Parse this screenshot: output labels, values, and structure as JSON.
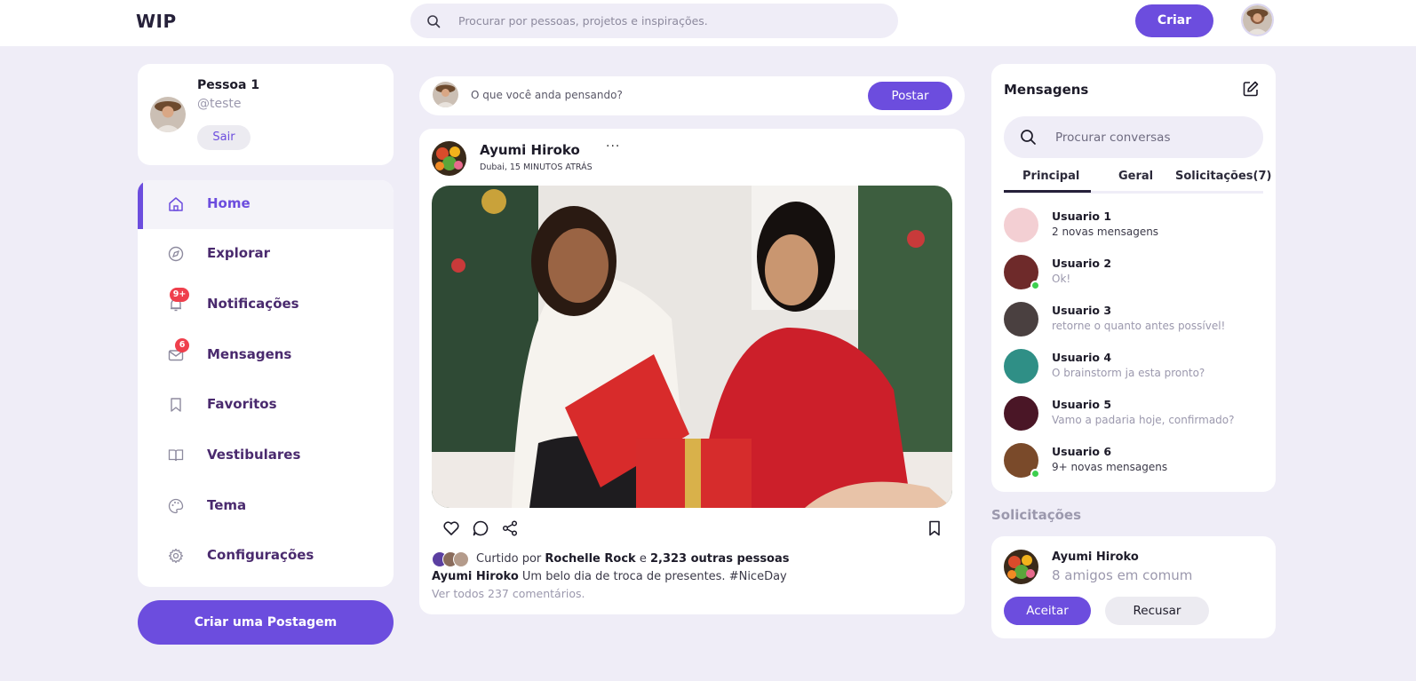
{
  "app": {
    "logo": "WIP"
  },
  "header": {
    "search_placeholder": "Procurar por pessoas, projetos e inspirações.",
    "create_label": "Criar"
  },
  "profile": {
    "name": "Pessoa 1",
    "handle": "@teste",
    "logout_label": "Sair"
  },
  "sidebar": {
    "items": [
      {
        "label": "Home",
        "icon": "home-icon",
        "active": true
      },
      {
        "label": "Explorar",
        "icon": "compass-icon"
      },
      {
        "label": "Notificações",
        "icon": "bell-icon",
        "badge": "9+"
      },
      {
        "label": "Mensagens",
        "icon": "mail-icon",
        "badge": "6"
      },
      {
        "label": "Favoritos",
        "icon": "bookmark-icon"
      },
      {
        "label": "Vestibulares",
        "icon": "book-icon"
      },
      {
        "label": "Tema",
        "icon": "palette-icon"
      },
      {
        "label": "Configurações",
        "icon": "gear-icon"
      }
    ],
    "create_post_label": "Criar uma Postagem"
  },
  "composer": {
    "placeholder": "O que você anda pensando?",
    "post_label": "Postar"
  },
  "post": {
    "author": "Ayumi Hiroko",
    "meta": "Dubai, 15 MINUTOS ATRÁS",
    "menu": "···",
    "likes_prefix": "Curtido por",
    "liked_by": "Rochelle Rock",
    "likes_joiner": "e",
    "likes_others": "2,323 outras pessoas",
    "caption_author": "Ayumi Hiroko",
    "caption_text": "Um belo dia de troca de presentes. #NiceDay",
    "comments_label": "Ver todos 237 comentários."
  },
  "messages": {
    "title": "Mensagens",
    "search_placeholder": "Procurar conversas",
    "tabs": [
      "Principal",
      "Geral",
      "Solicitações(7)"
    ],
    "conversations": [
      {
        "name": "Usuario 1",
        "message": "2 novas mensagens",
        "unread": true,
        "online": false
      },
      {
        "name": "Usuario 2",
        "message": "Ok!",
        "unread": false,
        "online": true
      },
      {
        "name": "Usuario 3",
        "message": "retorne o quanto antes possível!",
        "unread": false,
        "online": false
      },
      {
        "name": "Usuario 4",
        "message": "O brainstorm ja esta pronto?",
        "unread": false,
        "online": false
      },
      {
        "name": "Usuario 5",
        "message": "Vamo a padaria hoje, confirmado?",
        "unread": false,
        "online": false
      },
      {
        "name": "Usuario 6",
        "message": "9+ novas mensagens",
        "unread": true,
        "online": true
      }
    ]
  },
  "requests": {
    "title": "Solicitações",
    "name": "Ayumi Hiroko",
    "mutual": "8 amigos em comum",
    "accept_label": "Aceitar",
    "decline_label": "Recusar"
  },
  "colors": {
    "accent": "#6c4dde",
    "badge": "#ef3f4c",
    "online": "#3ccf4e",
    "background": "#efedf7"
  }
}
